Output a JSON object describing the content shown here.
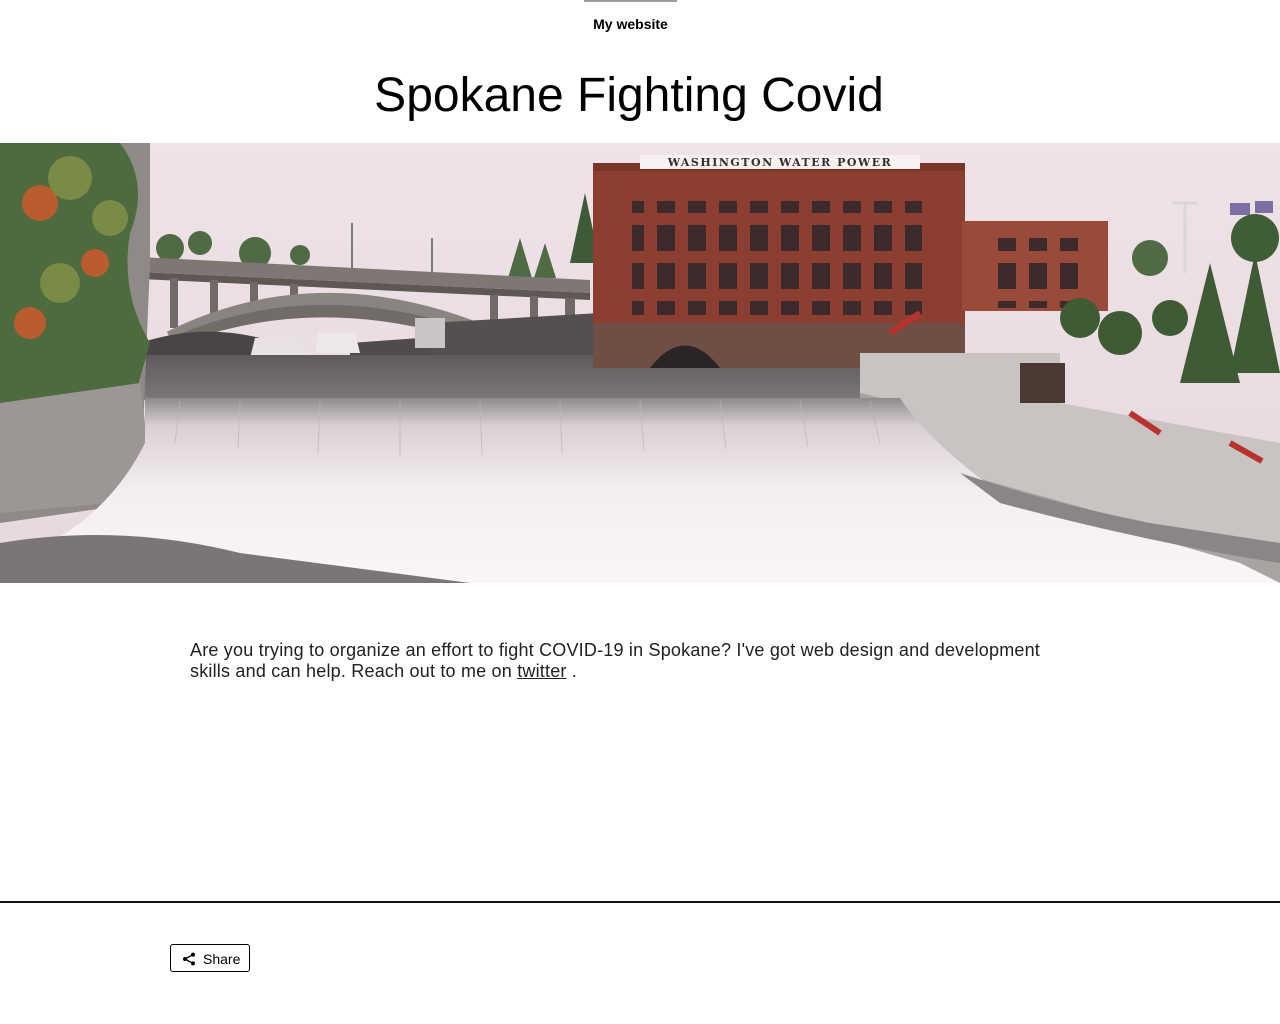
{
  "nav": {
    "site_name": "My website"
  },
  "page": {
    "title": "Spokane Fighting Covid"
  },
  "hero": {
    "building_sign": "WASHINGTON WATER POWER"
  },
  "content": {
    "intro_text": "Are you trying to organize an effort to fight COVID-19 in Spokane? I've got web design and development skills and can help. Reach out to me on",
    "link_text": "twitter",
    "trailing": " ."
  },
  "footer": {
    "share_label": "Share",
    "share_icon": "share-icon"
  }
}
